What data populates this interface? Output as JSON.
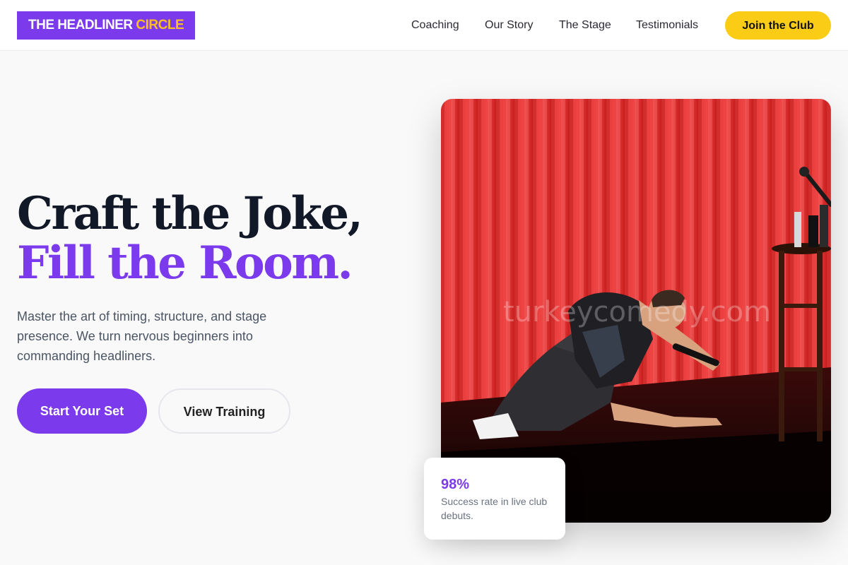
{
  "brand": {
    "name_main": "THE HEADLINER",
    "name_accent": "CIRCLE"
  },
  "nav": {
    "items": [
      {
        "label": "Coaching"
      },
      {
        "label": "Our Story"
      },
      {
        "label": "The Stage"
      },
      {
        "label": "Testimonials"
      }
    ],
    "cta_label": "Join the Club"
  },
  "hero": {
    "headline_line1": "Craft the Joke,",
    "headline_line2": "Fill the Room.",
    "description": "Master the art of timing, structure, and stage presence. We turn nervous beginners into commanding headliners.",
    "primary_button": "Start Your Set",
    "secondary_button": "View Training",
    "image_watermark": "turkeycomedy.com"
  },
  "stat": {
    "value": "98%",
    "label": "Success rate in live club debuts."
  },
  "colors": {
    "brand_purple": "#7c3aed",
    "accent_yellow": "#facc15",
    "logo_accent": "#fbbf24",
    "heading_dark": "#111827",
    "curtain_red": "#dc2626"
  }
}
